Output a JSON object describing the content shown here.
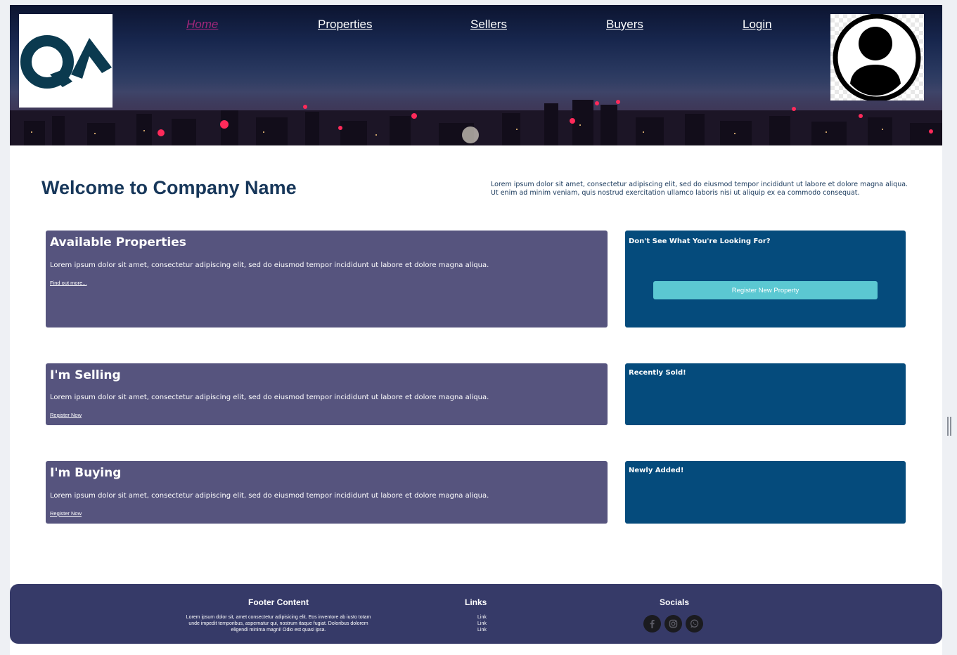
{
  "nav": {
    "items": [
      {
        "label": "Home",
        "active": true
      },
      {
        "label": "Properties",
        "active": false
      },
      {
        "label": "Sellers",
        "active": false
      },
      {
        "label": "Buyers",
        "active": false
      },
      {
        "label": "Login",
        "active": false
      }
    ]
  },
  "logo": {
    "text": "QA",
    "color": "#0b3a4f"
  },
  "hero": {
    "title": "Welcome to Company Name",
    "intro": "Lorem ipsum dolor sit amet, consectetur adipiscing elit, sed do eiusmod tempor incididunt ut labore et dolore magna aliqua. Ut enim ad minim veniam, quis nostrud exercitation ullamco laboris nisi ut aliquip ex ea commodo consequat."
  },
  "sections": {
    "available": {
      "title": "Available Properties",
      "text": "Lorem ipsum dolor sit amet, consectetur adipiscing elit, sed do eiusmod tempor incididunt ut labore et dolore magna aliqua.",
      "link": "Find out more..."
    },
    "selling": {
      "title": "I'm Selling",
      "text": "Lorem ipsum dolor sit amet, consectetur adipiscing elit, sed do eiusmod tempor incididunt ut labore et dolore magna aliqua.",
      "link": "Register Now"
    },
    "buying": {
      "title": "I'm Buying",
      "text": "Lorem ipsum dolor sit amet, consectetur adipiscing elit, sed do eiusmod tempor incididunt ut labore et dolore magna aliqua.",
      "link": "Register Now"
    }
  },
  "side": {
    "looking": {
      "title": "Don't See What You're Looking For?",
      "button": "Register New Property"
    },
    "sold": {
      "title": "Recently Sold!"
    },
    "added": {
      "title": "Newly Added!"
    }
  },
  "footer": {
    "content_title": "Footer Content",
    "content_text": "Lorem ipsum dolor sit, amet consectetur adipisicing elit. Eos inventore ab iusto totam unde impedit temporibus, aspernatur qui, nostrum itaque fugiat. Doloribus dolorem eligendi minima magni! Odio est quasi ipsa.",
    "links_title": "Links",
    "links": [
      "Link",
      "Link",
      "Link"
    ],
    "socials_title": "Socials",
    "socials": [
      "facebook-icon",
      "instagram-icon",
      "whatsapp-icon"
    ]
  },
  "colors": {
    "primary_card": "#56547e",
    "secondary_card": "#054b7c",
    "accent_button": "#5bc8d2",
    "footer": "#363a68",
    "heading": "#17375a",
    "active_nav": "#a0267a"
  }
}
